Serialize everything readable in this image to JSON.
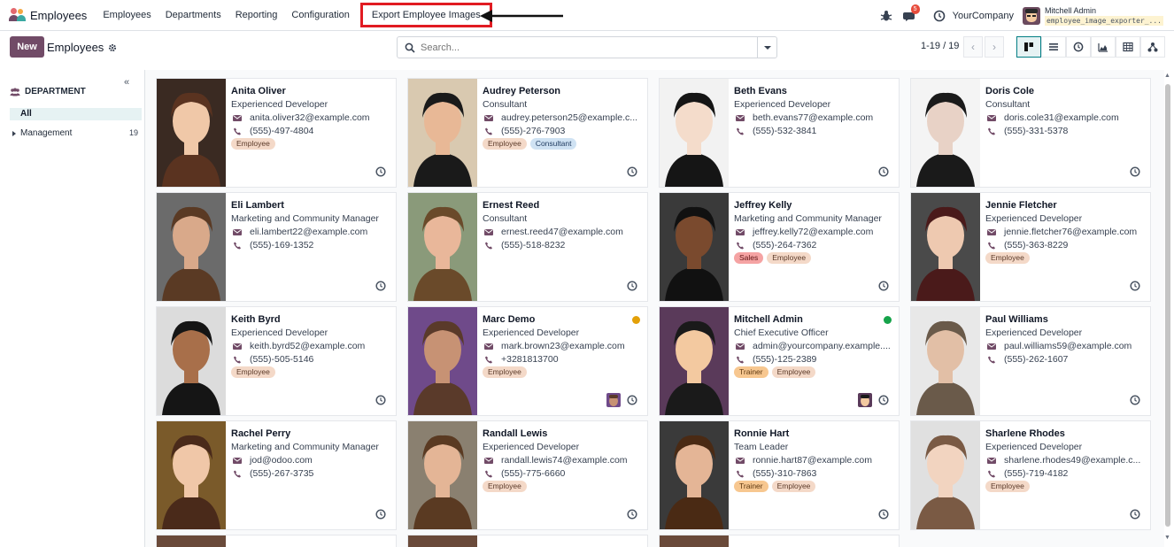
{
  "navbar": {
    "app_name": "Employees",
    "menu": [
      "Employees",
      "Departments",
      "Reporting",
      "Configuration"
    ],
    "export_label": "Export Employee Images",
    "chat_count": "5",
    "company": "YourCompany",
    "user_name": "Mitchell Admin",
    "database": "employee_image_exporter_..."
  },
  "control": {
    "new_label": "New",
    "title": "Employees",
    "search_placeholder": "Search...",
    "pager": "1-19 / 19"
  },
  "sidebar": {
    "heading": "DEPARTMENT",
    "all_label": "All",
    "items": [
      {
        "label": "Management",
        "count": "19"
      }
    ]
  },
  "employees": [
    {
      "name": "Anita Oliver",
      "job": "Experienced Developer",
      "email": "anita.oliver32@example.com",
      "phone": "(555)-497-4804",
      "tags": [
        "Employee"
      ]
    },
    {
      "name": "Audrey Peterson",
      "job": "Consultant",
      "email": "audrey.peterson25@example.c...",
      "phone": "(555)-276-7903",
      "tags": [
        "Employee",
        "Consultant"
      ]
    },
    {
      "name": "Beth Evans",
      "job": "Experienced Developer",
      "email": "beth.evans77@example.com",
      "phone": "(555)-532-3841",
      "tags": []
    },
    {
      "name": "Doris Cole",
      "job": "Consultant",
      "email": "doris.cole31@example.com",
      "phone": "(555)-331-5378",
      "tags": []
    },
    {
      "name": "Eli Lambert",
      "job": "Marketing and Community Manager",
      "email": "eli.lambert22@example.com",
      "phone": "(555)-169-1352",
      "tags": []
    },
    {
      "name": "Ernest Reed",
      "job": "Consultant",
      "email": "ernest.reed47@example.com",
      "phone": "(555)-518-8232",
      "tags": []
    },
    {
      "name": "Jeffrey Kelly",
      "job": "Marketing and Community Manager",
      "email": "jeffrey.kelly72@example.com",
      "phone": "(555)-264-7362",
      "tags": [
        "Sales",
        "Employee"
      ]
    },
    {
      "name": "Jennie Fletcher",
      "job": "Experienced Developer",
      "email": "jennie.fletcher76@example.com",
      "phone": "(555)-363-8229",
      "tags": [
        "Employee"
      ]
    },
    {
      "name": "Keith Byrd",
      "job": "Experienced Developer",
      "email": "keith.byrd52@example.com",
      "phone": "(555)-505-5146",
      "tags": [
        "Employee"
      ]
    },
    {
      "name": "Marc Demo",
      "job": "Experienced Developer",
      "email": "mark.brown23@example.com",
      "phone": "+3281813700",
      "tags": [
        "Employee"
      ]
    },
    {
      "name": "Mitchell Admin",
      "job": "Chief Executive Officer",
      "email": "admin@yourcompany.example....",
      "phone": "(555)-125-2389",
      "tags": [
        "Trainer",
        "Employee"
      ]
    },
    {
      "name": "Paul Williams",
      "job": "Experienced Developer",
      "email": "paul.williams59@example.com",
      "phone": "(555)-262-1607",
      "tags": []
    },
    {
      "name": "Rachel Perry",
      "job": "Marketing and Community Manager",
      "email": "jod@odoo.com",
      "phone": "(555)-267-3735",
      "tags": []
    },
    {
      "name": "Randall Lewis",
      "job": "Experienced Developer",
      "email": "randall.lewis74@example.com",
      "phone": "(555)-775-6660",
      "tags": [
        "Employee"
      ]
    },
    {
      "name": "Ronnie Hart",
      "job": "Team Leader",
      "email": "ronnie.hart87@example.com",
      "phone": "(555)-310-7863",
      "tags": [
        "Trainer",
        "Employee"
      ]
    },
    {
      "name": "Sharlene Rhodes",
      "job": "Experienced Developer",
      "email": "sharlene.rhodes49@example.c...",
      "phone": "(555)-719-4182",
      "tags": [
        "Employee"
      ]
    }
  ],
  "colors": {
    "brand": "#714b67",
    "accent": "#017e84",
    "highlight": "#e11b22"
  }
}
